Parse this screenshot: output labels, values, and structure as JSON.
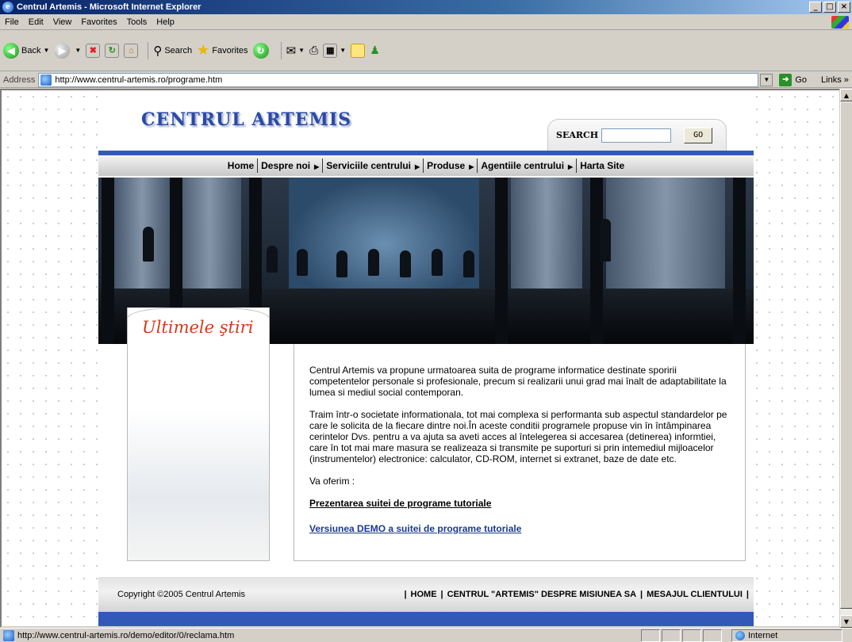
{
  "window": {
    "title": "Centrul Artemis - Microsoft Internet Explorer",
    "min_label": "_",
    "max_label": "□",
    "close_label": "×"
  },
  "menubar": {
    "items": [
      "File",
      "Edit",
      "View",
      "Favorites",
      "Tools",
      "Help"
    ]
  },
  "toolbar": {
    "back_label": "Back",
    "search_label": "Search",
    "favorites_label": "Favorites"
  },
  "addressbar": {
    "label": "Address",
    "url": "http://www.centrul-artemis.ro/programe.htm",
    "go_label": "Go",
    "links_label": "Links »"
  },
  "site": {
    "logo": "CENTRUL ARTEMIS",
    "search_label": "SEARCH",
    "search_value": "",
    "search_button": "GO",
    "nav": [
      {
        "label": "Home",
        "submenu": false
      },
      {
        "label": "Despre noi",
        "submenu": true
      },
      {
        "label": "Serviciile centrului",
        "submenu": true
      },
      {
        "label": "Produse",
        "submenu": true
      },
      {
        "label": "Agentiile centrului",
        "submenu": true
      },
      {
        "label": "Harta Site",
        "submenu": false
      }
    ],
    "news_title": "Ultimele ştiri",
    "paragraph1": "Centrul Artemis va propune urmatoarea suita de programe informatice destinate sporirii competentelor personale si profesionale, precum si realizarii unui grad mai înalt de adaptabilitate la lumea si mediul social contemporan.",
    "paragraph2": "Traim într-o societate informationala, tot mai complexa si performanta sub aspectul standardelor pe care le solicita de la fiecare dintre noi.În aceste conditii programele propuse vin în întâmpinarea cerintelor Dvs. pentru a va ajuta sa aveti acces al întelegerea si accesarea (detinerea) informtiei, care în tot mai mare masura se realizeaza si transmite pe suporturi si prin intemediul mijloacelor (instrumentelor) electronice: calculator, CD-ROM, internet si extranet, baze de date etc.",
    "offer_label": "Va oferim :",
    "link1": "Prezentarea suitei de programe tutoriale",
    "link2": "Versiunea DEMO a suitei de programe tutoriale",
    "copyright": "Copyright ©2005 Centrul Artemis",
    "footer_links": [
      "HOME",
      "CENTRUL \"ARTEMIS\" DESPRE MISIUNEA SA",
      "MESAJUL CLIENTULUI"
    ]
  },
  "statusbar": {
    "text": "http://www.centrul-artemis.ro/demo/editor/0/reclama.htm",
    "zone": "Internet"
  }
}
